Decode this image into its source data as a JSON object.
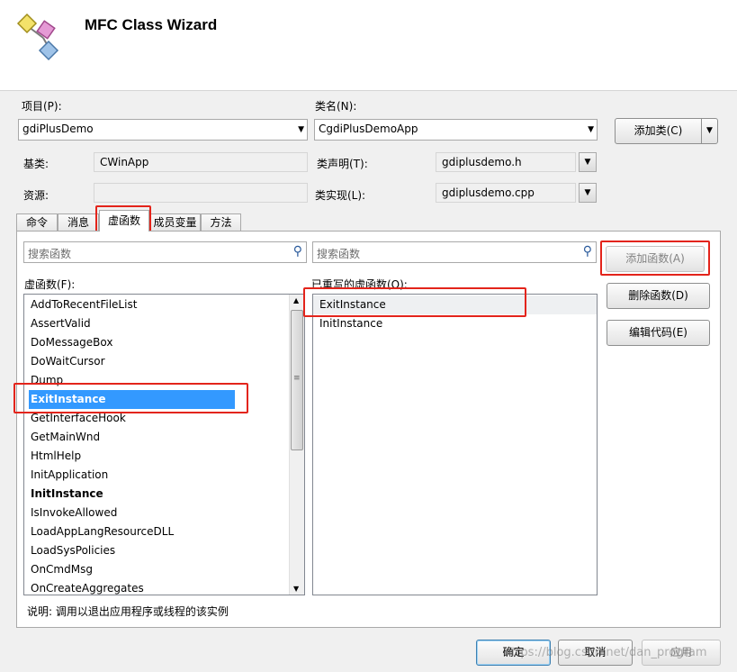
{
  "window": {
    "title": "MFC Class Wizard"
  },
  "project": {
    "label": "项目(P):",
    "value": "gdiPlusDemo"
  },
  "class_name": {
    "label": "类名(N):",
    "value": "CgdiPlusDemoApp"
  },
  "add_class_button": "添加类(C)",
  "base_class": {
    "label": "基类:",
    "value": "CWinApp"
  },
  "resource": {
    "label": "资源:",
    "value": ""
  },
  "class_declaration": {
    "label": "类声明(T):",
    "value": "gdiplusdemo.h"
  },
  "class_implementation": {
    "label": "类实现(L):",
    "value": "gdiplusdemo.cpp"
  },
  "tabs": [
    {
      "label": "命令"
    },
    {
      "label": "消息"
    },
    {
      "label": "虚函数"
    },
    {
      "label": "成员变量"
    },
    {
      "label": "方法"
    }
  ],
  "left_search": {
    "placeholder": "搜索函数"
  },
  "right_search": {
    "placeholder": "搜索函数"
  },
  "virtual_functions": {
    "label": "虚函数(F):",
    "items": [
      "AddToRecentFileList",
      "AssertValid",
      "DoMessageBox",
      "DoWaitCursor",
      "Dump",
      "ExitInstance",
      "GetInterfaceHook",
      "GetMainWnd",
      "HtmlHelp",
      "InitApplication",
      "InitInstance",
      "IsInvokeAllowed",
      "LoadAppLangResourceDLL",
      "LoadSysPolicies",
      "OnCmdMsg",
      "OnCreateAggregates"
    ]
  },
  "overridden_functions": {
    "label": "已重写的虚函数(O):",
    "items": [
      "ExitInstance",
      "InitInstance"
    ]
  },
  "buttons": {
    "add_function": "添加函数(A)",
    "delete_function": "删除函数(D)",
    "edit_code": "编辑代码(E)",
    "ok": "确定",
    "cancel": "取消",
    "apply": "应用"
  },
  "description": "说明:   调用以退出应用程序或线程的该实例",
  "watermark": "https://blog.csdn.net/dan_program",
  "colors": {
    "selection": "#3399ff",
    "highlight_box": "#e3241b"
  }
}
